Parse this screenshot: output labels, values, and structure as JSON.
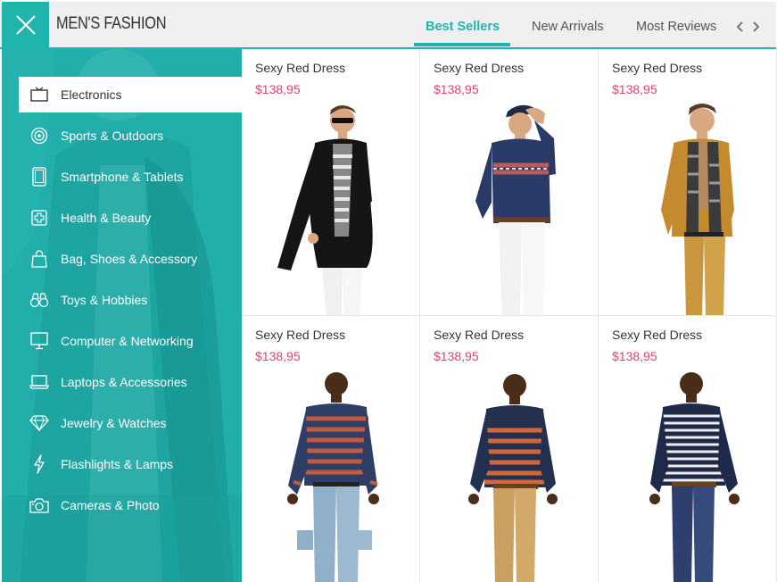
{
  "header": {
    "title": "MEN'S FASHION",
    "close_icon": "close-x-icon",
    "tabs": [
      {
        "label": "Best Sellers",
        "active": true
      },
      {
        "label": "New Arrivals",
        "active": false
      },
      {
        "label": "Most Reviews",
        "active": false
      }
    ],
    "prev_icon": "chevron-left-icon",
    "next_icon": "chevron-right-icon"
  },
  "sidebar": {
    "items": [
      {
        "label": "Electronics",
        "icon": "tv-icon",
        "active": true
      },
      {
        "label": "Sports & Outdoors",
        "icon": "target-icon",
        "active": false
      },
      {
        "label": "Smartphone & Tablets",
        "icon": "smartphone-icon",
        "active": false
      },
      {
        "label": "Health & Beauty",
        "icon": "medical-cross-icon",
        "active": false
      },
      {
        "label": "Bag, Shoes & Accessory",
        "icon": "shopping-bag-icon",
        "active": false
      },
      {
        "label": "Toys & Hobbies",
        "icon": "binoculars-icon",
        "active": false
      },
      {
        "label": "Computer & Networking",
        "icon": "monitor-icon",
        "active": false
      },
      {
        "label": "Laptops & Accessories",
        "icon": "laptop-icon",
        "active": false
      },
      {
        "label": "Jewelry & Watches",
        "icon": "diamond-icon",
        "active": false
      },
      {
        "label": "Flashlights & Lamps",
        "icon": "lightning-icon",
        "active": false
      },
      {
        "label": "Cameras & Photo",
        "icon": "camera-icon",
        "active": false
      }
    ]
  },
  "products": [
    {
      "name": "Sexy Red Dress",
      "price": "$138,95"
    },
    {
      "name": "Sexy Red Dress",
      "price": "$138,95"
    },
    {
      "name": "Sexy Red Dress",
      "price": "$138,95"
    },
    {
      "name": "Sexy Red Dress",
      "price": "$138,95"
    },
    {
      "name": "Sexy Red Dress",
      "price": "$138,95"
    },
    {
      "name": "Sexy Red Dress",
      "price": "$138,95"
    }
  ],
  "colors": {
    "accent": "#1fb5ad",
    "price": "#e2416a",
    "header_bg": "#efefef",
    "sidebar_bg": "#22aeab"
  }
}
